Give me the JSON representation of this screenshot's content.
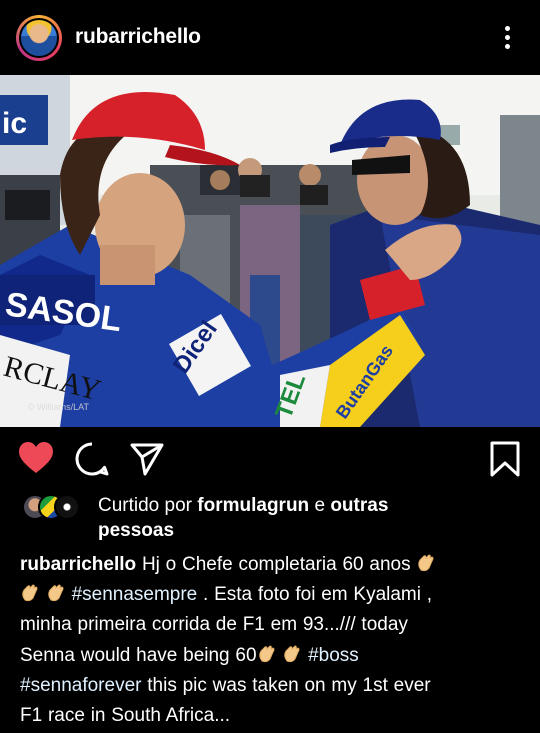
{
  "post": {
    "username": "rubarrichello",
    "image_credit": "© Williams/LAT",
    "likes": {
      "prefix": "Curtido por",
      "user": "formulagrun",
      "conj": "e",
      "others": "outras",
      "others2": "pessoas"
    },
    "caption": {
      "username": "rubarrichello",
      "line1": "Hj o Chefe completaria 60 anos",
      "tag1": "#sennasempre",
      "line2": ". Esta foto foi em Kyalami ,",
      "line3": "minha primeira corrida de F1 em 93.../// today",
      "line4": "Senna would have being 60",
      "tag2": "#boss",
      "tag3": "#sennaforever",
      "line5": "this pic was taken on my 1st ever",
      "line6": "F1 race in South Africa..."
    }
  },
  "icons": {
    "more": "more-vertical-icon",
    "like": "heart-filled-icon",
    "comment": "comment-icon",
    "share": "send-icon",
    "save": "bookmark-icon",
    "emoji": "clapping-hands-emoji"
  },
  "colors": {
    "background": "#000000",
    "like_heart": "#ed4956",
    "text": "#ffffff"
  }
}
